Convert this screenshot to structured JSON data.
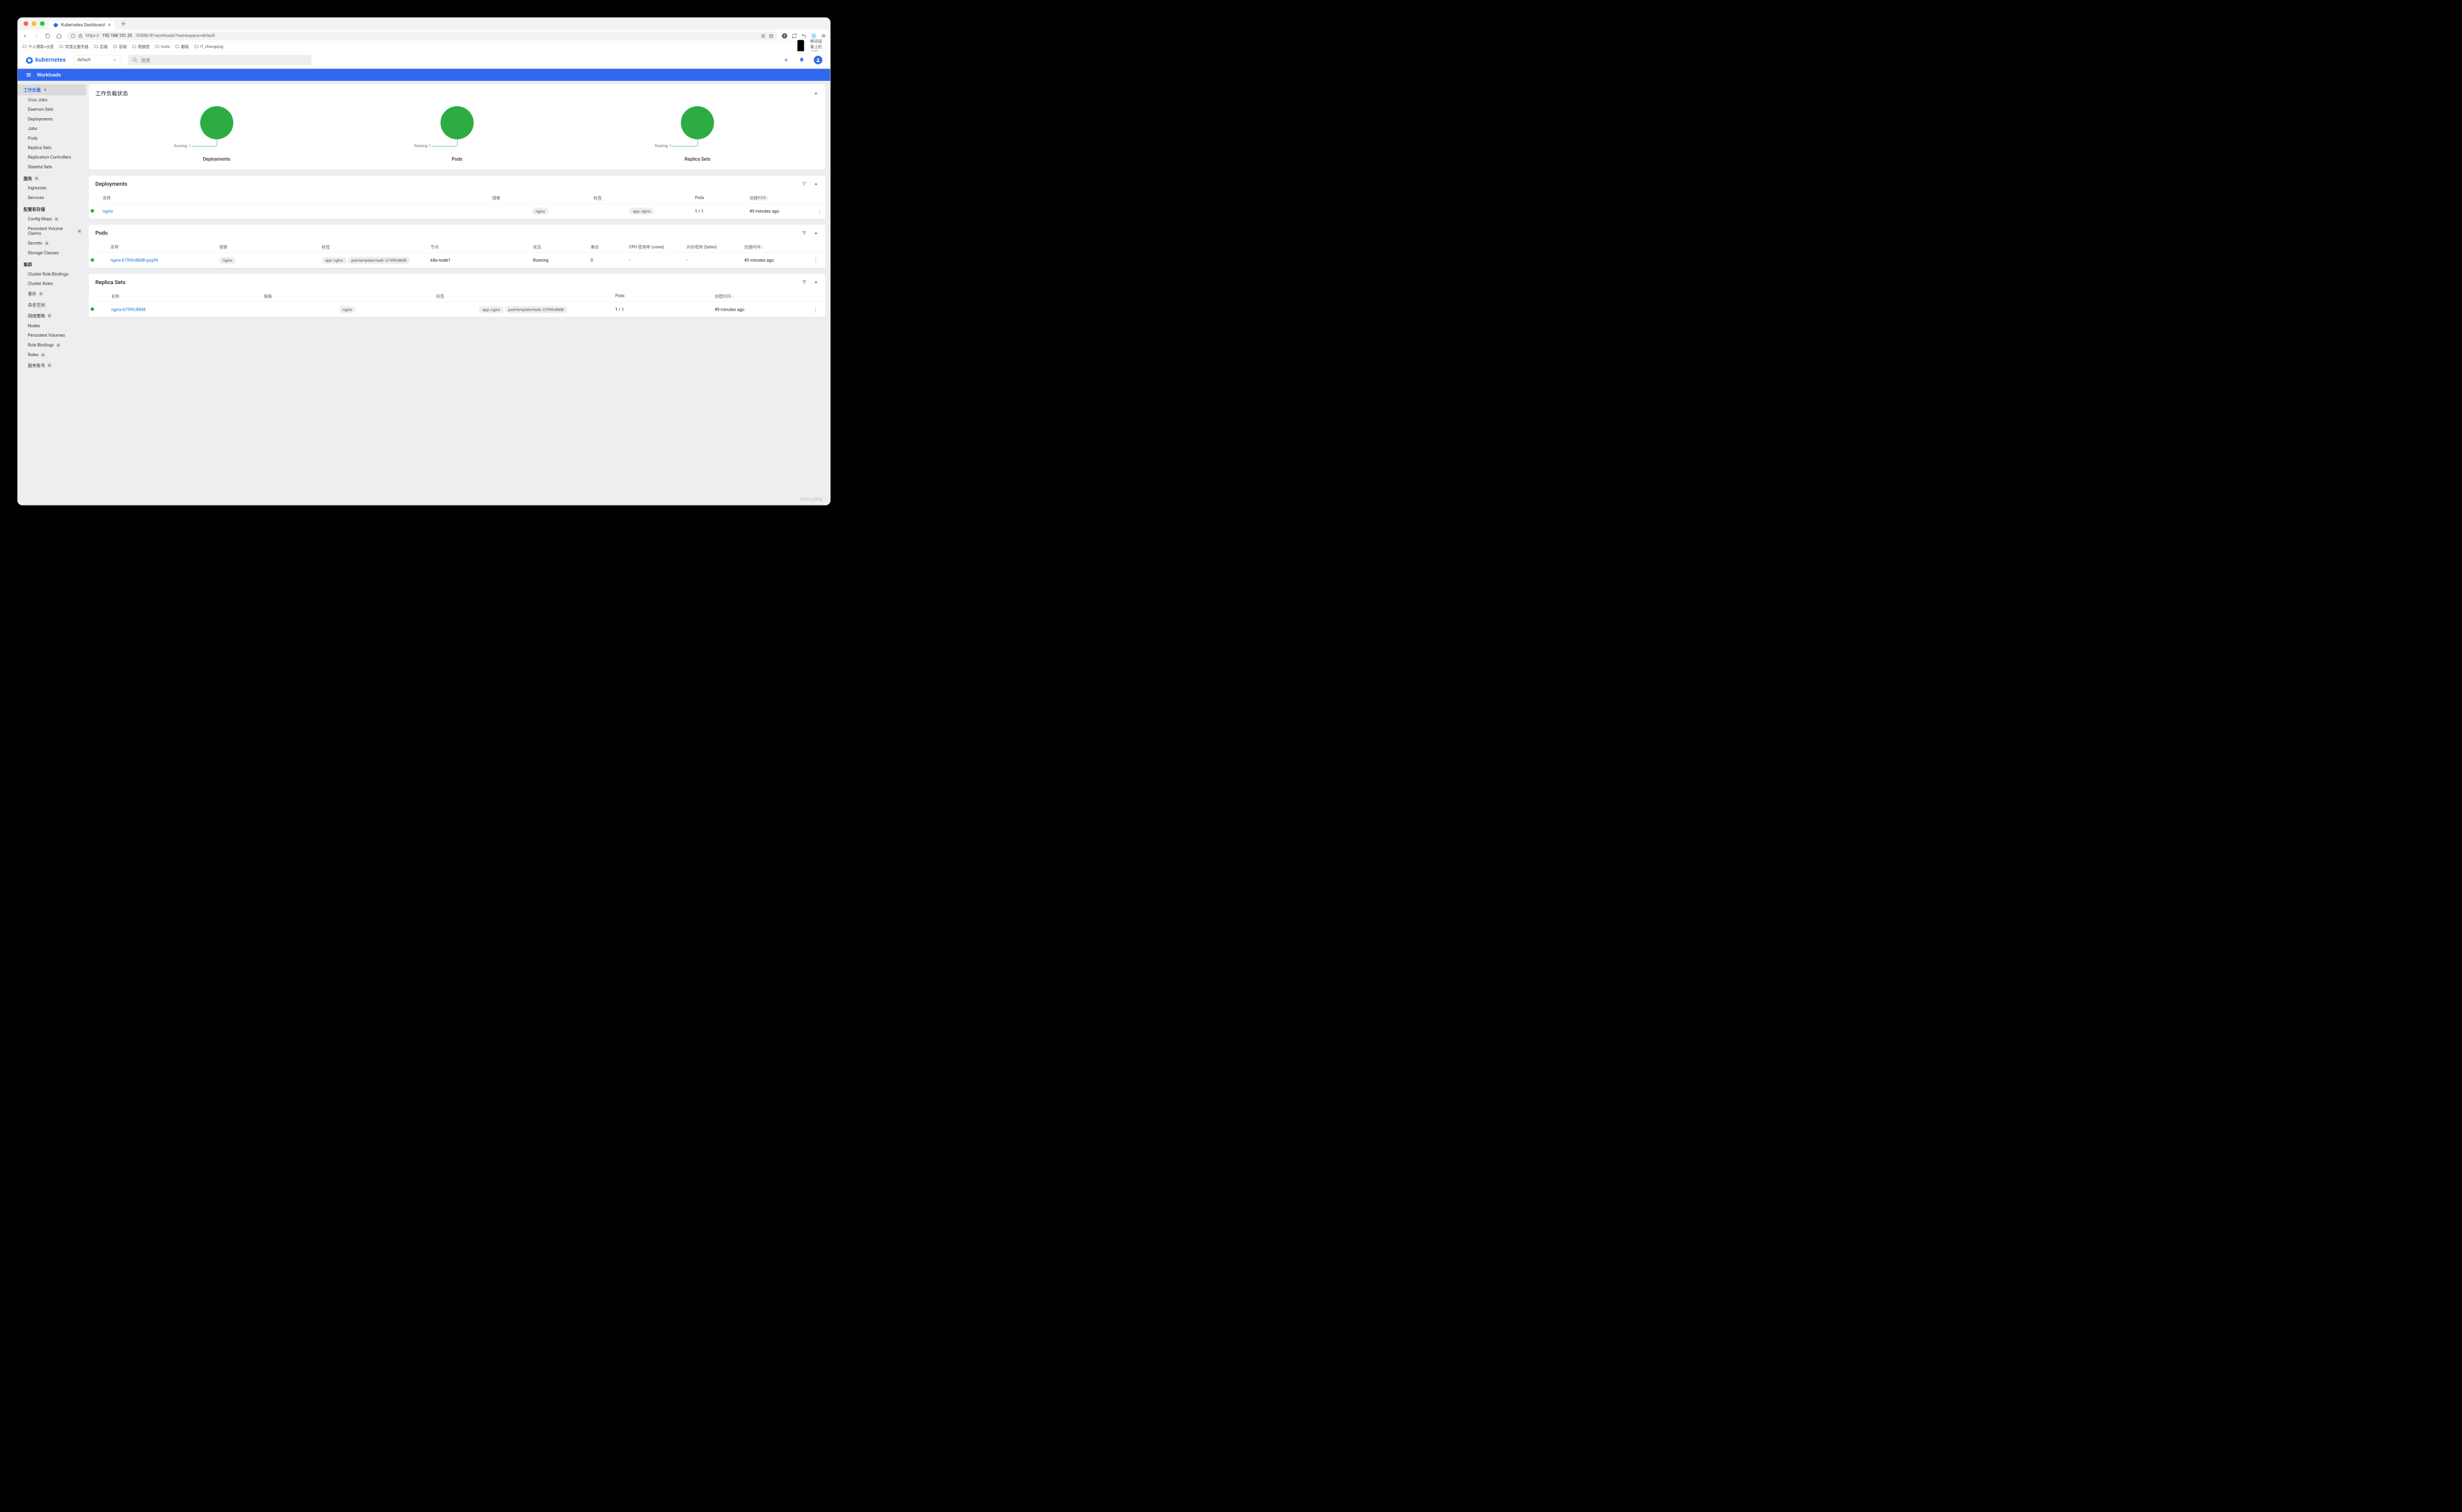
{
  "browser": {
    "tab_title": "Kubernetes Dashboard",
    "url_display_prefix": "https://",
    "url_display_host": "192.168.101.20",
    "url_display_path": ":30586/#!/workloads?namespace=default",
    "reader_badge": "阅",
    "bookmarks": [
      "个人博客+仓库",
      "阿里云服务器",
      "后端",
      "前端",
      "数据库",
      "tools",
      "翻墙",
      "IT_zhengqing"
    ],
    "bookmarks_right": "移动设备上的书签"
  },
  "header": {
    "brand": "kubernetes",
    "namespace": "default",
    "search_placeholder": "搜索"
  },
  "bluebar": {
    "title": "Workloads"
  },
  "sidebar": {
    "items": [
      {
        "label": "工作负载",
        "badge": "N",
        "type": "head",
        "active": true
      },
      {
        "label": "Cron Jobs",
        "type": "child"
      },
      {
        "label": "Daemon Sets",
        "type": "child"
      },
      {
        "label": "Deployments",
        "type": "child"
      },
      {
        "label": "Jobs",
        "type": "child"
      },
      {
        "label": "Pods",
        "type": "child"
      },
      {
        "label": "Replica Sets",
        "type": "child"
      },
      {
        "label": "Replication Controllers",
        "type": "child"
      },
      {
        "label": "Stateful Sets",
        "type": "child"
      },
      {
        "label": "服务",
        "badge": "N",
        "type": "head"
      },
      {
        "label": "Ingresses",
        "type": "child"
      },
      {
        "label": "Services",
        "type": "child"
      },
      {
        "label": "配置和存储",
        "type": "head"
      },
      {
        "label": "Config Maps",
        "badge": "N",
        "type": "child"
      },
      {
        "label": "Persistent Volume Claims",
        "badge": "N",
        "type": "child"
      },
      {
        "label": "Secrets",
        "badge": "N",
        "type": "child"
      },
      {
        "label": "Storage Classes",
        "type": "child"
      },
      {
        "label": "集群",
        "type": "head"
      },
      {
        "label": "Cluster Role Bindings",
        "type": "child"
      },
      {
        "label": "Cluster Roles",
        "type": "child"
      },
      {
        "label": "事件",
        "badge": "N",
        "type": "child"
      },
      {
        "label": "命名空间",
        "type": "child"
      },
      {
        "label": "网络策略",
        "badge": "N",
        "type": "child"
      },
      {
        "label": "Nodes",
        "type": "child"
      },
      {
        "label": "Persistent Volumes",
        "type": "child"
      },
      {
        "label": "Role Bindings",
        "badge": "N",
        "type": "child"
      },
      {
        "label": "Roles",
        "badge": "N",
        "type": "child"
      },
      {
        "label": "服务账号",
        "badge": "N",
        "type": "child"
      }
    ]
  },
  "status_card": {
    "title": "工作负载状态",
    "items": [
      {
        "label": "Deployments",
        "legend": "Running: 1"
      },
      {
        "label": "Pods",
        "legend": "Running: 1"
      },
      {
        "label": "Replica Sets",
        "legend": "Running: 1"
      }
    ]
  },
  "deployments": {
    "title": "Deployments",
    "cols": {
      "name": "名称",
      "image": "镜像",
      "labels": "标签",
      "pods": "Pods",
      "created": "创建时间"
    },
    "rows": [
      {
        "name": "nginx",
        "image": "nginx",
        "labels": [
          "app: nginx"
        ],
        "pods": "1 / 1",
        "created": "49 minutes ago"
      }
    ]
  },
  "pods": {
    "title": "Pods",
    "cols": {
      "name": "名称",
      "image": "镜像",
      "labels": "标签",
      "node": "节点",
      "status": "状态",
      "restarts": "重启",
      "cpu": "CPU 使用率 (cores)",
      "mem": "内存使用 (bytes)",
      "created": "创建时间"
    },
    "rows": [
      {
        "name": "nginx-6799fc88d8-qsg99",
        "image": "nginx",
        "labels": [
          "app: nginx",
          "pod-template-hash: 6799fc88d8"
        ],
        "node": "k8s-node1",
        "status": "Running",
        "restarts": "0",
        "cpu": "-",
        "mem": "-",
        "created": "49 minutes ago"
      }
    ]
  },
  "replicasets": {
    "title": "Replica Sets",
    "cols": {
      "name": "名称",
      "image": "镜像",
      "labels": "标签",
      "pods": "Pods",
      "created": "创建时间"
    },
    "rows": [
      {
        "name": "nginx-6799fc88d8",
        "image": "nginx",
        "labels": [
          "app: nginx",
          "pod-template-hash: 6799fc88d8"
        ],
        "pods": "1 / 1",
        "created": "49 minutes ago"
      }
    ]
  },
  "watermark": "CSDN @郑清"
}
